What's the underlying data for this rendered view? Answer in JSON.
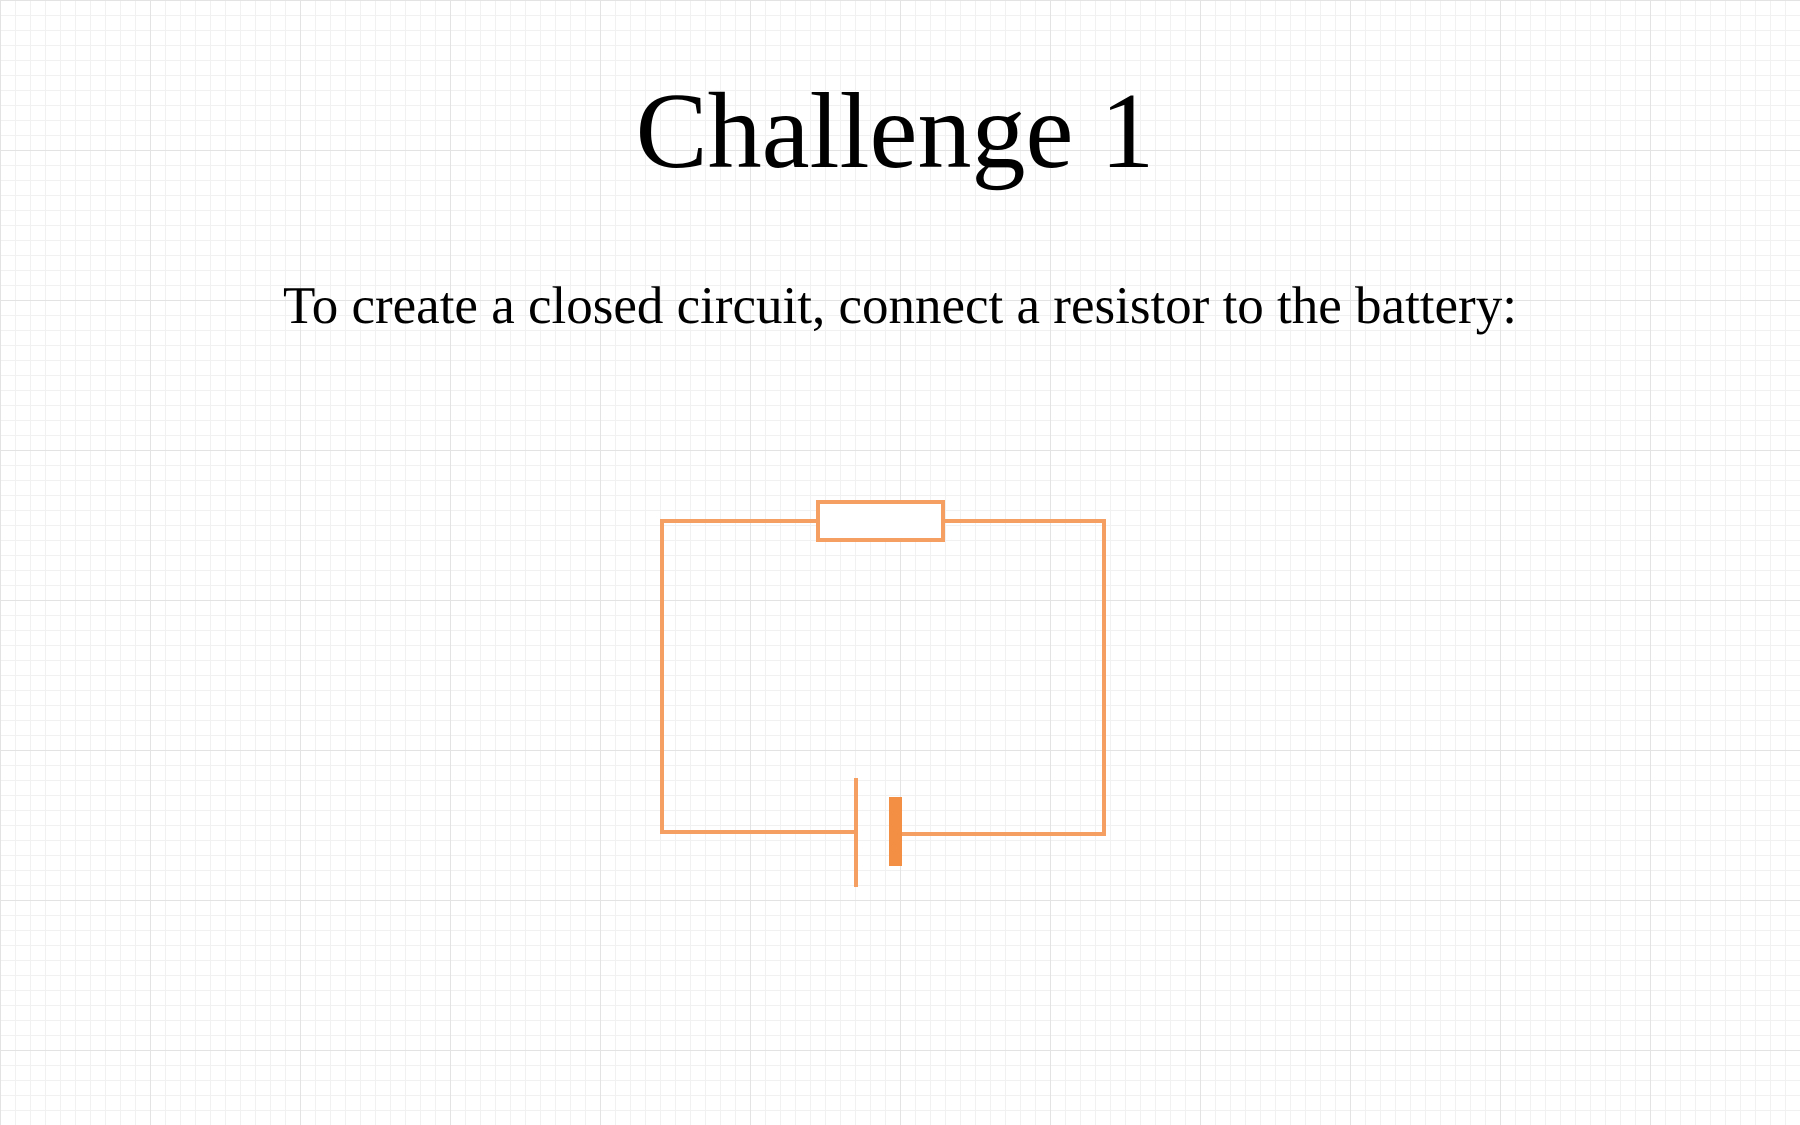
{
  "page": {
    "title": "Challenge 1",
    "instruction": "To create a closed circuit, connect a resistor to the battery:"
  },
  "circuit": {
    "components": [
      "resistor",
      "battery",
      "wire"
    ],
    "wire_color": "#f5a062",
    "battery_color": "#f28f45"
  }
}
